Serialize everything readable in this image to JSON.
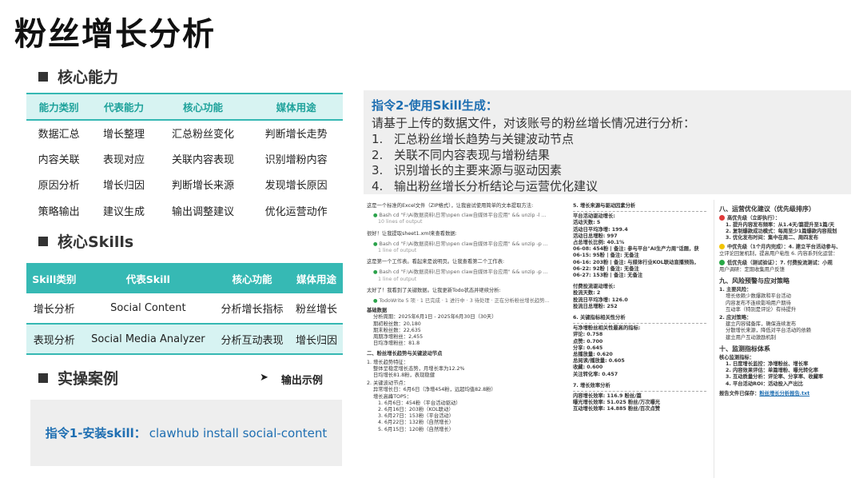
{
  "page_title": "粉丝增长分析",
  "sec_core_ability": "核心能力",
  "sec_core_skills": "核心Skills",
  "sec_cases": "实操案例",
  "output_example": {
    "arrow": "➤",
    "label": "输出示例"
  },
  "ability_table": {
    "headers": [
      "能力类别",
      "代表能力",
      "核心功能",
      "媒体用途"
    ],
    "rows": [
      [
        "数据汇总",
        "增长整理",
        "汇总粉丝变化",
        "判断增长走势"
      ],
      [
        "内容关联",
        "表现对应",
        "关联内容表现",
        "识别增粉内容"
      ],
      [
        "原因分析",
        "增长归因",
        "判断增长来源",
        "发现增长原因"
      ],
      [
        "策略输出",
        "建议生成",
        "输出调整建议",
        "优化运营动作"
      ]
    ]
  },
  "skills_table": {
    "headers": [
      "Skill类别",
      "代表Skill",
      "核心功能",
      "媒体用途"
    ],
    "rows": [
      [
        "增长分析",
        "Social Content",
        "分析增长指标",
        "粉丝增长"
      ],
      [
        "表现分析",
        "Social Media Analyzer",
        "分析互动表现",
        "增长归因"
      ]
    ]
  },
  "install": {
    "label": "指令1-安装skill：",
    "command": "clawhub install social-content"
  },
  "instruction2": {
    "title": "指令2-使用Skill生成：",
    "intro": "请基于上传的数据文件，对该账号的粉丝增长情况进行分析：",
    "items": [
      {
        "n": "1.",
        "text": "汇总粉丝增长趋势与关键波动节点"
      },
      {
        "n": "2.",
        "text": "关联不同内容表现与增粉结果"
      },
      {
        "n": "3.",
        "text": "识别增长的主要来源与驱动因素"
      },
      {
        "n": "4.",
        "text": "输出粉丝增长分析结论与运营优化建议"
      }
    ]
  },
  "shot1": {
    "l1": "这是一个标准的Excel文件（ZIP格式），让我尝试使用简单的文本提取方法:",
    "bash1": "Bash  cd \"F:\\Ai数据资料\\日常\\open claw自媒体平台应用\" && unzip -l ...",
    "bash1_sub": "10 lines of output",
    "l2": "很好！让我提取sheet1.xml来查看数据:",
    "bash2": "Bash  cd \"F:\\Ai数据资料\\日常\\open claw自媒体平台应用\" && unzip -p ...",
    "bash2_sub": "1 line of output",
    "l3": "这是第一个工作表。看起来是说明页。让我查看第二个工作表:",
    "bash3": "Bash  cd \"F:\\Ai数据资料\\日常\\open claw自媒体平台应用\" && unzip -p ...",
    "bash3_sub": "1 line of output",
    "l4": "太好了！我看到了关键数据。让我更新Todo状态并继续分析:",
    "todo": "TodoWrite  5 项 · 1 已完成 · 1 进行中 · 3 待处理 · 正在分析粉丝增长趋势...",
    "basic_title": "基础数据",
    "basic": [
      "分析周期：2025年6月1日 - 2025年6月30日（30天）",
      "期初粉丝数：20,180",
      "期末粉丝数：22,635",
      "周期净增粉丝：2,455",
      "日均净增粉丝：81.8"
    ],
    "sec2": "二、粉丝增长趋势与关键波动节点",
    "sec2_1": "1. 增长趋势特征：",
    "sec2_1_items": [
      "整体呈稳定增长态势，月增长率为12.2%",
      "日均增长81.8粉，表现稳健"
    ],
    "sec2_2": "2. 关键波动节点：",
    "sec2_2_a": "异常增长日：6月6日（净增454粉，远超均值82.8粉）",
    "sec2_2_b": "增长高峰TOP5：",
    "top5": [
      "1. 6月6日：454粉（平台活动驱动）",
      "2. 6月16日：203粉（KOL联动）",
      "3. 6月27日：153粉（平台活动）",
      "4. 6月22日：132粉（自然增长）",
      "5. 6月15日：120粉（自然增长）"
    ]
  },
  "shot2": {
    "title": "5. 增长来源与驱动因素分析",
    "p1_title": "平台活动驱动增长:",
    "p1": [
      "活动天数: 5",
      "活动日平均净增: 199.4",
      "活动日总增粉: 997",
      "占总增长比例: 40.1%"
    ],
    "p1_days": [
      "06-08: 454粉 | 备注: 参与平台\"AI生产力周\"话题，获",
      "06-15: 95粉 | 备注: 无备注",
      "06-16: 203粉 | 备注: 与媒体行业KOL联动直播预热，",
      "06-22: 92粉 | 备注: 无备注",
      "06-27: 153粉 | 备注: 无备注"
    ],
    "p2_title": "付费投流驱动增长:",
    "p2": [
      "投流天数: 2",
      "投流日平均净增: 126.0",
      "投流日总增粉: 252"
    ],
    "sec6": "6. 关键指标相关性分析",
    "p3_title": "与净增粉丝相关性最高的指标:",
    "p3": [
      "评论: 0.758",
      "点赞: 0.700",
      "分享: 0.645",
      "总播放量: 0.620",
      "总阅读/播放量: 0.605",
      "收藏: 0.600",
      "关注转化率: 0.457"
    ],
    "sec7": "7. 增长效率分析",
    "p4": [
      "内容增长效率: 116.9 粉丝/篇",
      "曝光增长效率: 51.025 粉丝/万次曝光",
      "互动增长效率: 14.885 粉丝/百次点赞"
    ]
  },
  "shot3": {
    "sec8": "八、运营优化建议（优先级排序）",
    "high": "高优先级（立即执行）：",
    "high_items": [
      "1. 提升内容发布频率：从1.4天/篇提升至1篇/天",
      "2. 复制爆款成功模式：每周至少1篇爆款内容规划",
      "3. 优化发布时间：集中在周二、周四发布"
    ],
    "mid": "中优先级（1个月内完成）：4. 建立平台活动参与、",
    "mid_sub": "立评论回复机制，提高用户粘性 6. 内容系列化运营：",
    "low": "低优先级（测试验证）：7. 付费投流测试：小规",
    "low_sub": "用户调研：定期收集用户反馈",
    "sec9": "九、风险预警与应对策略",
    "risk_title": "1. 主要风险：",
    "risk_items": [
      "增长依赖少数爆款和平台活动",
      "内容发布不连续影响用户期待",
      "互动率（特别是评论）有待提升"
    ],
    "resp_title": "2. 应对策略：",
    "resp_items": [
      "建立内容储备库，确保连续发布",
      "分散增长来源，降低对平台活动的依赖",
      "建立用户互动激励机制"
    ],
    "sec10": "十、监测指标体系",
    "mon_title": "核心监测指标：",
    "mon_items": [
      "1. 日度增长监控：净增粉丝、增长率",
      "2. 内容效果评估：单篇增粉、曝光转化率",
      "3. 互动质量分析：评论率、分享率、收藏率",
      "4. 平台活动ROI：活动投入产出比"
    ],
    "report_label": "报告文件已保存：",
    "report_file": "粉丝增长分析报告.txt"
  }
}
